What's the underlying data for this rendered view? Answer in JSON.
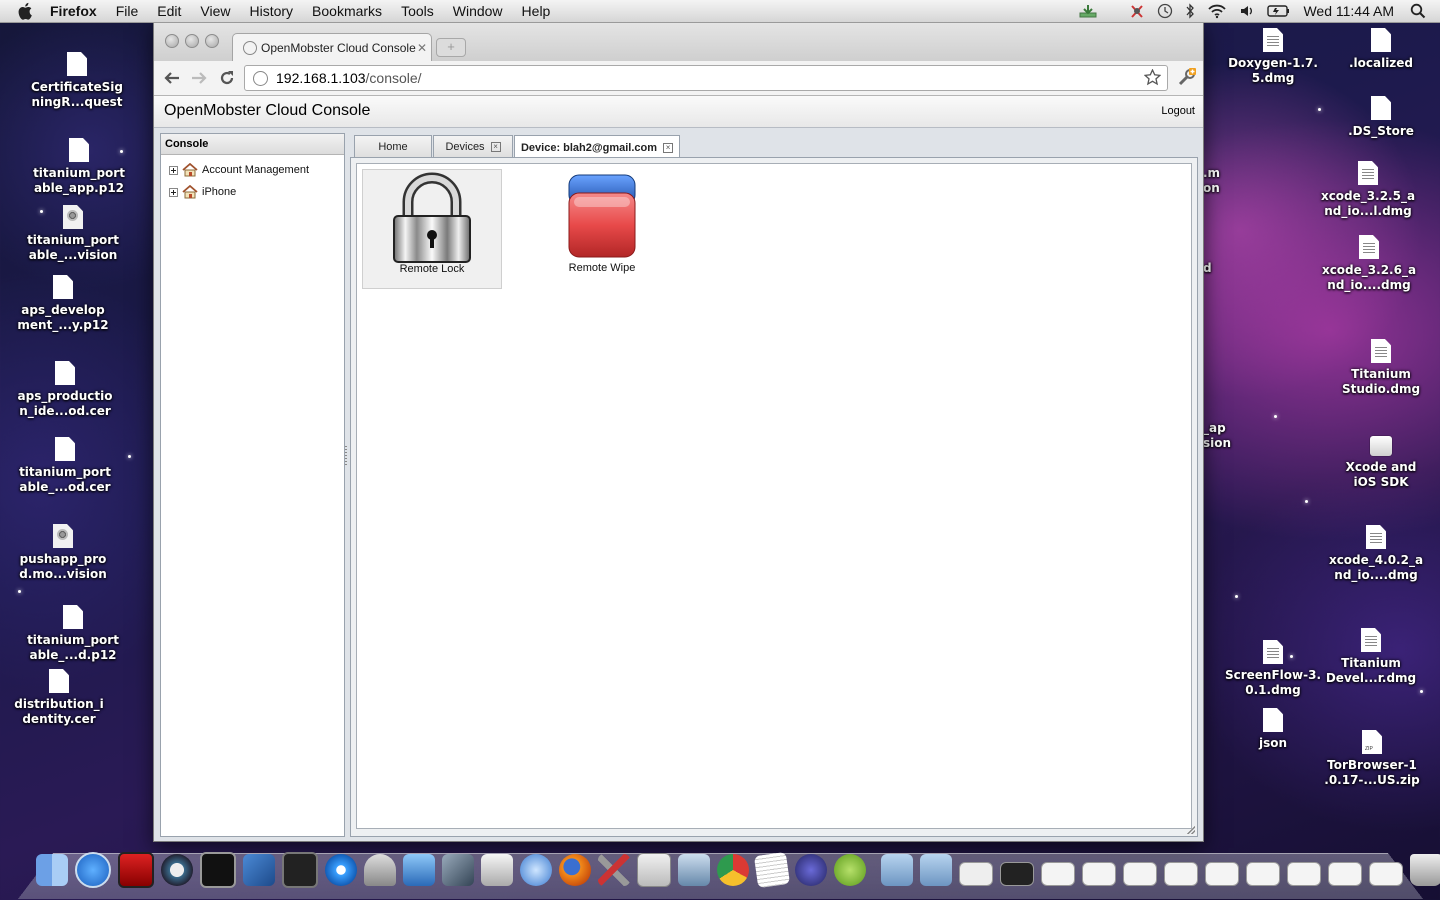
{
  "menubar": {
    "app": "Firefox",
    "items": [
      "File",
      "Edit",
      "View",
      "History",
      "Bookmarks",
      "Tools",
      "Window",
      "Help"
    ],
    "clock": "Wed 11:44 AM"
  },
  "desktop_left": [
    {
      "label1": "CertificateSig",
      "label2": "ningR...quest",
      "icon": "doc"
    },
    {
      "label1": "titanium_port",
      "label2": "able_app.p12",
      "icon": "blank"
    },
    {
      "label1": "titanium_port",
      "label2": "able_...vision",
      "icon": "prov"
    },
    {
      "label1": "aps_develop",
      "label2": "ment_...y.p12",
      "icon": "blank"
    },
    {
      "label1": "aps_productio",
      "label2": "n_ide...od.cer",
      "icon": "blank"
    },
    {
      "label1": "titanium_port",
      "label2": "able_...od.cer",
      "icon": "blank"
    },
    {
      "label1": "pushapp_pro",
      "label2": "d.mo...vision",
      "icon": "prov"
    },
    {
      "label1": "titanium_port",
      "label2": "able_...d.p12",
      "icon": "blank"
    },
    {
      "label1": "distribution_i",
      "label2": "dentity.cer",
      "icon": "blank"
    }
  ],
  "desktop_right": [
    {
      "label1": "Doxygen-1.7.",
      "label2": "5.dmg",
      "icon": "doc"
    },
    {
      "label1": ".localized",
      "label2": "",
      "icon": "blank"
    },
    {
      "label1": ".DS_Store",
      "label2": "",
      "icon": "blank"
    },
    {
      "label1": "xcode_3.2.5_a",
      "label2": "nd_io...l.dmg",
      "icon": "doc"
    },
    {
      "label1": "xcode_3.2.6_a",
      "label2": "nd_io....dmg",
      "icon": "doc"
    },
    {
      "label1": "Titanium",
      "label2": "Studio.dmg",
      "icon": "doc"
    },
    {
      "label1": "Xcode and",
      "label2": "iOS SDK",
      "icon": "drive"
    },
    {
      "label1": "xcode_4.0.2_a",
      "label2": "nd_io....dmg",
      "icon": "doc"
    },
    {
      "label1": "ScreenFlow-3.",
      "label2": "0.1.dmg",
      "icon": "doc"
    },
    {
      "label1": "Titanium",
      "label2": "Devel...r.dmg",
      "icon": "doc"
    },
    {
      "label1": "json",
      "label2": "",
      "icon": "blank"
    },
    {
      "label1": "TorBrowser-1",
      "label2": ".0.17-...US.zip",
      "icon": "zip"
    }
  ],
  "desktop_partial": [
    ".m",
    "on",
    "d",
    "_ap",
    "sion"
  ],
  "browser": {
    "tab_title": "OpenMobster Cloud Console",
    "new_tab": "+",
    "url_host": "192.168.1.103",
    "url_path": "/console/"
  },
  "app": {
    "title": "OpenMobster Cloud Console",
    "logout": "Logout",
    "panel_title": "Console",
    "tree": [
      "Account Management",
      "iPhone"
    ],
    "tabs": [
      {
        "label": "Home",
        "closable": false
      },
      {
        "label": "Devices",
        "closable": true
      },
      {
        "label": "Device: blah2@gmail.com",
        "closable": true,
        "active": true
      }
    ],
    "actions": [
      {
        "label": "Remote Lock",
        "icon": "padlock-icon",
        "selected": true
      },
      {
        "label": "Remote Wipe",
        "icon": "eraser-icon",
        "selected": false
      }
    ]
  },
  "dock": {
    "items": [
      "Finder",
      "App Store",
      "Photo Booth",
      "Time Machine",
      "Terminal",
      "Xcode",
      "Console",
      "iTunes",
      "Keychain Access",
      "Instruments",
      "X11",
      "Disk Utility",
      "Mail",
      "Firefox",
      "System Tools",
      "Preview",
      "Mail",
      "Google Chrome",
      "TextEdit",
      "Eclipse",
      "Android SDK",
      "Applications",
      "Documents",
      "Window",
      "Terminal",
      "Window",
      "Window",
      "Window",
      "Window",
      "Window",
      "Window",
      "Window",
      "Window",
      "Window",
      "Window",
      "Trash"
    ]
  },
  "colors": {
    "accent_red": "#e84a4a",
    "accent_blue": "#2a5fb8",
    "panel_border": "#99a2ad"
  }
}
